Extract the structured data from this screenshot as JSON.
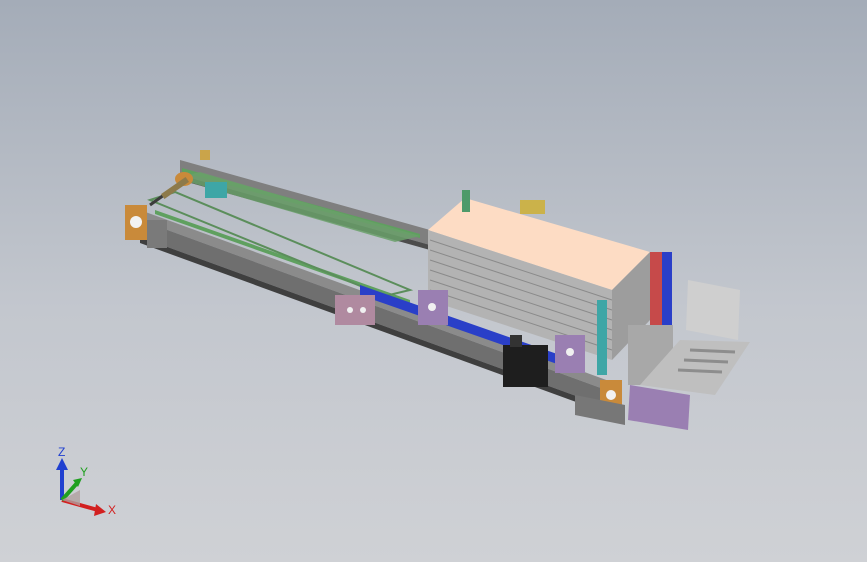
{
  "viewport": {
    "background_top": "#a4acb8",
    "background_bottom": "#cfd1d5"
  },
  "model": {
    "description_icon": "conveyor-assembly-3d-model",
    "colors": {
      "rail": "#8c8c8c",
      "rail_dark": "#5d5d5d",
      "belt": "#6aa06a",
      "carton": "#fddcc4",
      "carton_side": "#d8d2c8",
      "carton_stack": "#a7a7a7",
      "bracket_pink": "#b08aa0",
      "bracket_purple": "#9a7fb2",
      "blue_rail": "#2a3fc8",
      "motor_orange": "#c98a3a",
      "black": "#1e1e1e",
      "roller": "#c8c8c8",
      "plate_gray": "#aaaaaa",
      "red_bracket": "#c64a4a",
      "green_part": "#4d9a6a",
      "yellow_part": "#cbb24a",
      "teal_part": "#3ea6a6"
    }
  },
  "triad": {
    "x_label": "X",
    "y_label": "Y",
    "z_label": "Z",
    "x_color": "#d22020",
    "y_color": "#20a020",
    "z_color": "#2040d0"
  }
}
